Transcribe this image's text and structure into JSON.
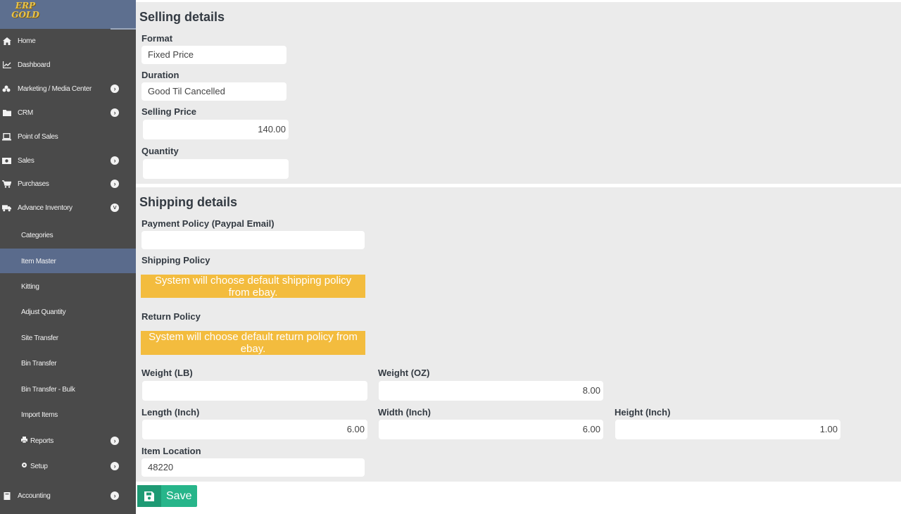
{
  "logo": {
    "text_line1": "ERP",
    "text_line2": "GOLD"
  },
  "sidebar": {
    "items": [
      {
        "label": "Home",
        "icon": "home-icon",
        "glyph": "⌂",
        "has_chevron": false
      },
      {
        "label": "Dashboard",
        "icon": "chart-icon",
        "glyph": "📈",
        "has_chevron": false
      },
      {
        "label": "Marketing / Media Center",
        "icon": "bullhorn-icon",
        "glyph": "✇",
        "has_chevron": true
      },
      {
        "label": "CRM",
        "icon": "folder-icon",
        "glyph": "▬",
        "has_chevron": true
      },
      {
        "label": "Point of Sales",
        "icon": "laptop-icon",
        "glyph": "▭",
        "has_chevron": false
      },
      {
        "label": "Sales",
        "icon": "money-icon",
        "glyph": "▣",
        "has_chevron": true
      },
      {
        "label": "Purchases",
        "icon": "cart-icon",
        "glyph": "🛒",
        "has_chevron": true
      },
      {
        "label": "Advance Inventory",
        "icon": "truck-icon",
        "glyph": "🚚",
        "has_chevron": true,
        "expanded": true
      }
    ],
    "subitems": [
      {
        "label": "Categories"
      },
      {
        "label": "Item Master",
        "active": true
      },
      {
        "label": "Kitting"
      },
      {
        "label": "Adjust Quantity"
      },
      {
        "label": "Site Transfer"
      },
      {
        "label": "Bin Transfer"
      },
      {
        "label": "Bin Transfer - Bulk"
      },
      {
        "label": "Import Items"
      },
      {
        "label": "Reports",
        "icon": "print-icon",
        "has_chevron": true
      },
      {
        "label": "Setup",
        "icon": "gear-icon",
        "has_chevron": true
      }
    ],
    "accounting": {
      "label": "Accounting",
      "icon": "book-icon",
      "has_chevron": true
    }
  },
  "selling": {
    "title": "Selling details",
    "format_label": "Format",
    "format_value": "Fixed Price",
    "duration_label": "Duration",
    "duration_value": "Good Til Cancelled",
    "price_label": "Selling Price",
    "price_value": "140.00",
    "quantity_label": "Quantity",
    "quantity_value": ""
  },
  "shipping": {
    "title": "Shipping details",
    "payment_label": "Payment Policy (Paypal Email)",
    "payment_value": "",
    "shipping_policy_label": "Shipping Policy",
    "shipping_policy_notice_line1": "System will choose default shipping policy",
    "shipping_policy_notice_line2": "from ebay.",
    "return_policy_label": "Return Policy",
    "return_policy_notice_line1": "System will choose default return policy from",
    "return_policy_notice_line2": "ebay.",
    "weight_lb_label": "Weight (LB)",
    "weight_lb_value": "",
    "weight_oz_label": "Weight (OZ)",
    "weight_oz_value": "8.00",
    "length_label": "Length (Inch)",
    "length_value": "6.00",
    "width_label": "Width (Inch)",
    "width_value": "6.00",
    "height_label": "Height (Inch)",
    "height_value": "1.00",
    "location_label": "Item Location",
    "location_value": "48220"
  },
  "actions": {
    "save_label": "Save"
  },
  "colors": {
    "sidebar_bg": "#4a4a4a",
    "sidebar_active": "#5a6b8c",
    "panel_bg": "#ebebeb",
    "notice": "#f3bc3e",
    "save_button": "#27b58a"
  }
}
